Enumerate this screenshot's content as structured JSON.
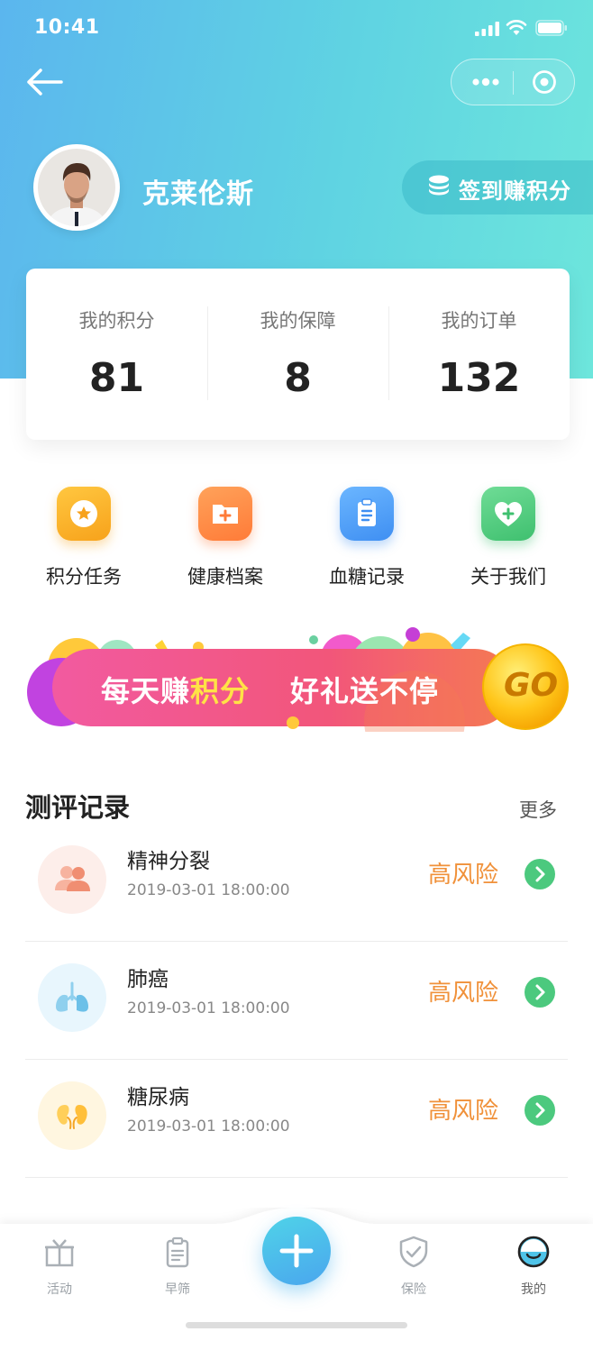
{
  "status_bar": {
    "time": "10:41"
  },
  "profile": {
    "name": "克莱伦斯",
    "signin_label": "签到赚积分"
  },
  "stats": [
    {
      "label": "我的积分",
      "value": "81"
    },
    {
      "label": "我的保障",
      "value": "8"
    },
    {
      "label": "我的订单",
      "value": "132"
    }
  ],
  "quick_entries": [
    {
      "label": "积分任务",
      "icon": "star-icon",
      "color": "#f9a825"
    },
    {
      "label": "健康档案",
      "icon": "folder-plus-icon",
      "color": "#ff8a3d"
    },
    {
      "label": "血糖记录",
      "icon": "clipboard-icon",
      "color": "#4a9ef5"
    },
    {
      "label": "关于我们",
      "icon": "heart-plus-icon",
      "color": "#4cc97e"
    }
  ],
  "banner": {
    "text_part1": "每天赚",
    "text_highlight": "积分",
    "text_part2": "好礼送不停",
    "go_label": "GO"
  },
  "records": {
    "title": "测评记录",
    "more_label": "更多",
    "items": [
      {
        "name": "精神分裂",
        "date": "2019-03-01 18:00:00",
        "risk": "高风险",
        "icon": "people-icon"
      },
      {
        "name": "肺癌",
        "date": "2019-03-01 18:00:00",
        "risk": "高风险",
        "icon": "lungs-icon"
      },
      {
        "name": "糖尿病",
        "date": "2019-03-01 18:00:00",
        "risk": "高风险",
        "icon": "kidney-icon"
      }
    ]
  },
  "tabbar": {
    "tabs": [
      {
        "label": "活动",
        "icon": "gift-icon"
      },
      {
        "label": "早筛",
        "icon": "clipboard-icon"
      },
      {
        "label": "保险",
        "icon": "shield-check-icon"
      },
      {
        "label": "我的",
        "icon": "face-icon"
      }
    ],
    "active": "我的"
  },
  "colors": {
    "accent": "#4fc3e8",
    "risk": "#f0913a",
    "go_green": "#4cc97e"
  }
}
